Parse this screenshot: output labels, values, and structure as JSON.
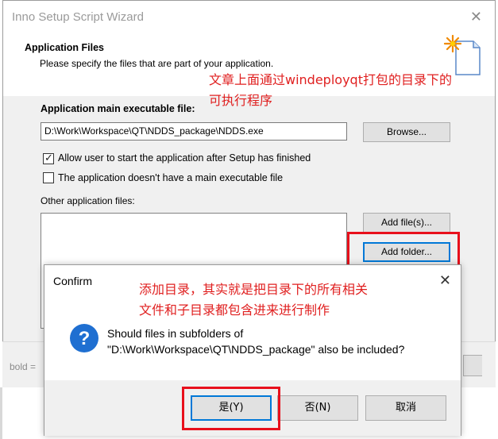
{
  "wizard": {
    "title": "Inno Setup Script Wizard",
    "close_glyph": "✕",
    "section_title": "Application Files",
    "section_subtitle": "Please specify the files that are part of your application.",
    "exe_label": "Application main executable file:",
    "exe_value": "D:\\Work\\Workspace\\QT\\NDDS_package\\NDDS.exe",
    "browse_label": "Browse...",
    "checkbox_allow_label": "Allow user to start the application after Setup has finished",
    "checkbox_allow_checked": true,
    "checkbox_noexe_label": "The application doesn't have a main executable file",
    "checkbox_noexe_checked": false,
    "other_files_label": "Other application files:",
    "add_files_label": "Add file(s)...",
    "add_folder_label": "Add folder...",
    "bottom_label": "bold ="
  },
  "annotations": {
    "note_top_line1": "文章上面通过windeployqt打包的目录下的",
    "note_top_line2": "可执行程序",
    "note_dialog_line1": "添加目录，其实就是把目录下的所有相关",
    "note_dialog_line2": "文件和子目录都包含进来进行制作",
    "color": "#e02020"
  },
  "dialog": {
    "title": "Confirm",
    "close_glyph": "✕",
    "icon": "question-icon",
    "message_line1": "Should files in subfolders of",
    "message_line2": "\"D:\\Work\\Workspace\\QT\\NDDS_package\" also be included?",
    "yes_label": "是(Y)",
    "no_label": "否(N)",
    "cancel_label": "取消"
  },
  "colors": {
    "highlight_box": "#e8101c",
    "focus_blue": "#0078d7",
    "icon_blue": "#1f6fd1"
  }
}
